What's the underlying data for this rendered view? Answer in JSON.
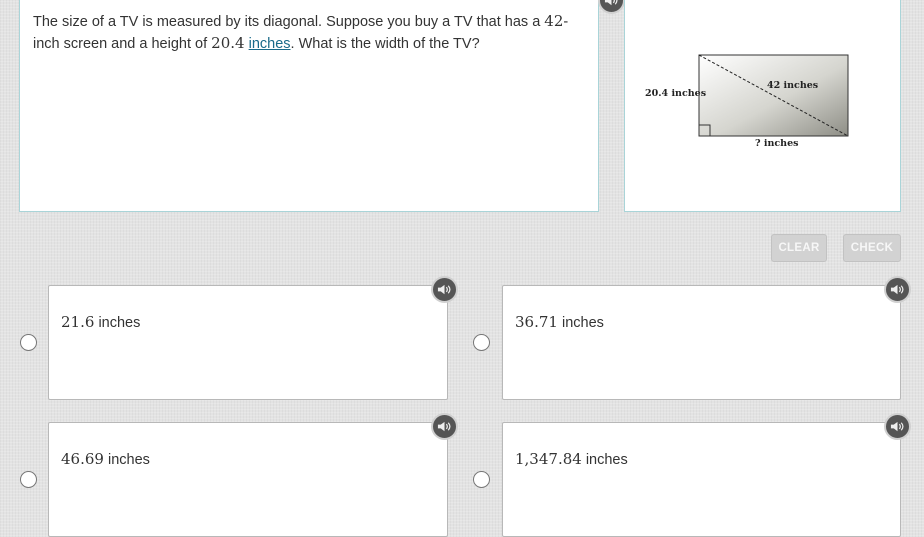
{
  "question": {
    "text_before": "The size of a TV is measured by its diagonal. Suppose you buy a TV that has a ",
    "diagonal_value": "42",
    "text_middle": "-inch screen and a height of ",
    "height_value": "20.4",
    "link_text": "inches",
    "text_after": ". What is the width of the TV?"
  },
  "figure": {
    "height_label": "20.4 inches",
    "diagonal_label": "42 inches",
    "width_label": "? inches"
  },
  "buttons": {
    "clear": "CLEAR",
    "check": "CHECK"
  },
  "choices": [
    {
      "value": "21.6",
      "unit": "inches"
    },
    {
      "value": "36.71",
      "unit": "inches"
    },
    {
      "value": "46.69",
      "unit": "inches"
    },
    {
      "value": "1,347.84",
      "unit": "inches"
    }
  ],
  "icons": {
    "audio": "speaker-icon"
  },
  "colors": {
    "panel_border": "#a9d4d8",
    "link": "#1a6a8a",
    "button_bg": "#d2d2d2"
  }
}
